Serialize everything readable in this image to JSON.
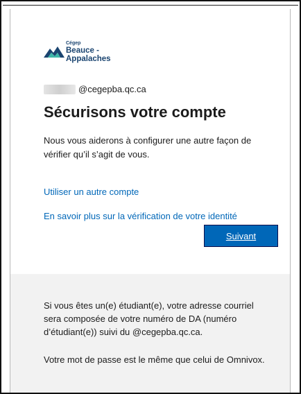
{
  "logo": {
    "small_text": "Cégep",
    "line1": "Beauce -",
    "line2": "Appalaches"
  },
  "account": {
    "email_domain": "@cegepba.qc.ca"
  },
  "title": "Sécurisons votre compte",
  "description": "Nous vous aiderons à configurer une autre façon de vérifier qu’il s’agit de vous.",
  "links": {
    "other_account": "Utiliser un autre compte",
    "learn_more": "En savoir plus sur la vérification de votre identité"
  },
  "buttons": {
    "next": "Suivant"
  },
  "info": {
    "paragraph1": "Si vous êtes un(e) étudiant(e), votre adresse courriel sera composée de votre numéro de DA (numéro d’étudiant(e)) suivi du @cegepba.qc.ca.",
    "paragraph2": "Votre mot de passe est le même que celui de Omnivox."
  },
  "colors": {
    "accent": "#0067b8",
    "logo": "#1a4470",
    "logo_light": "#3eb6a8",
    "panel": "#f2f2f2"
  }
}
